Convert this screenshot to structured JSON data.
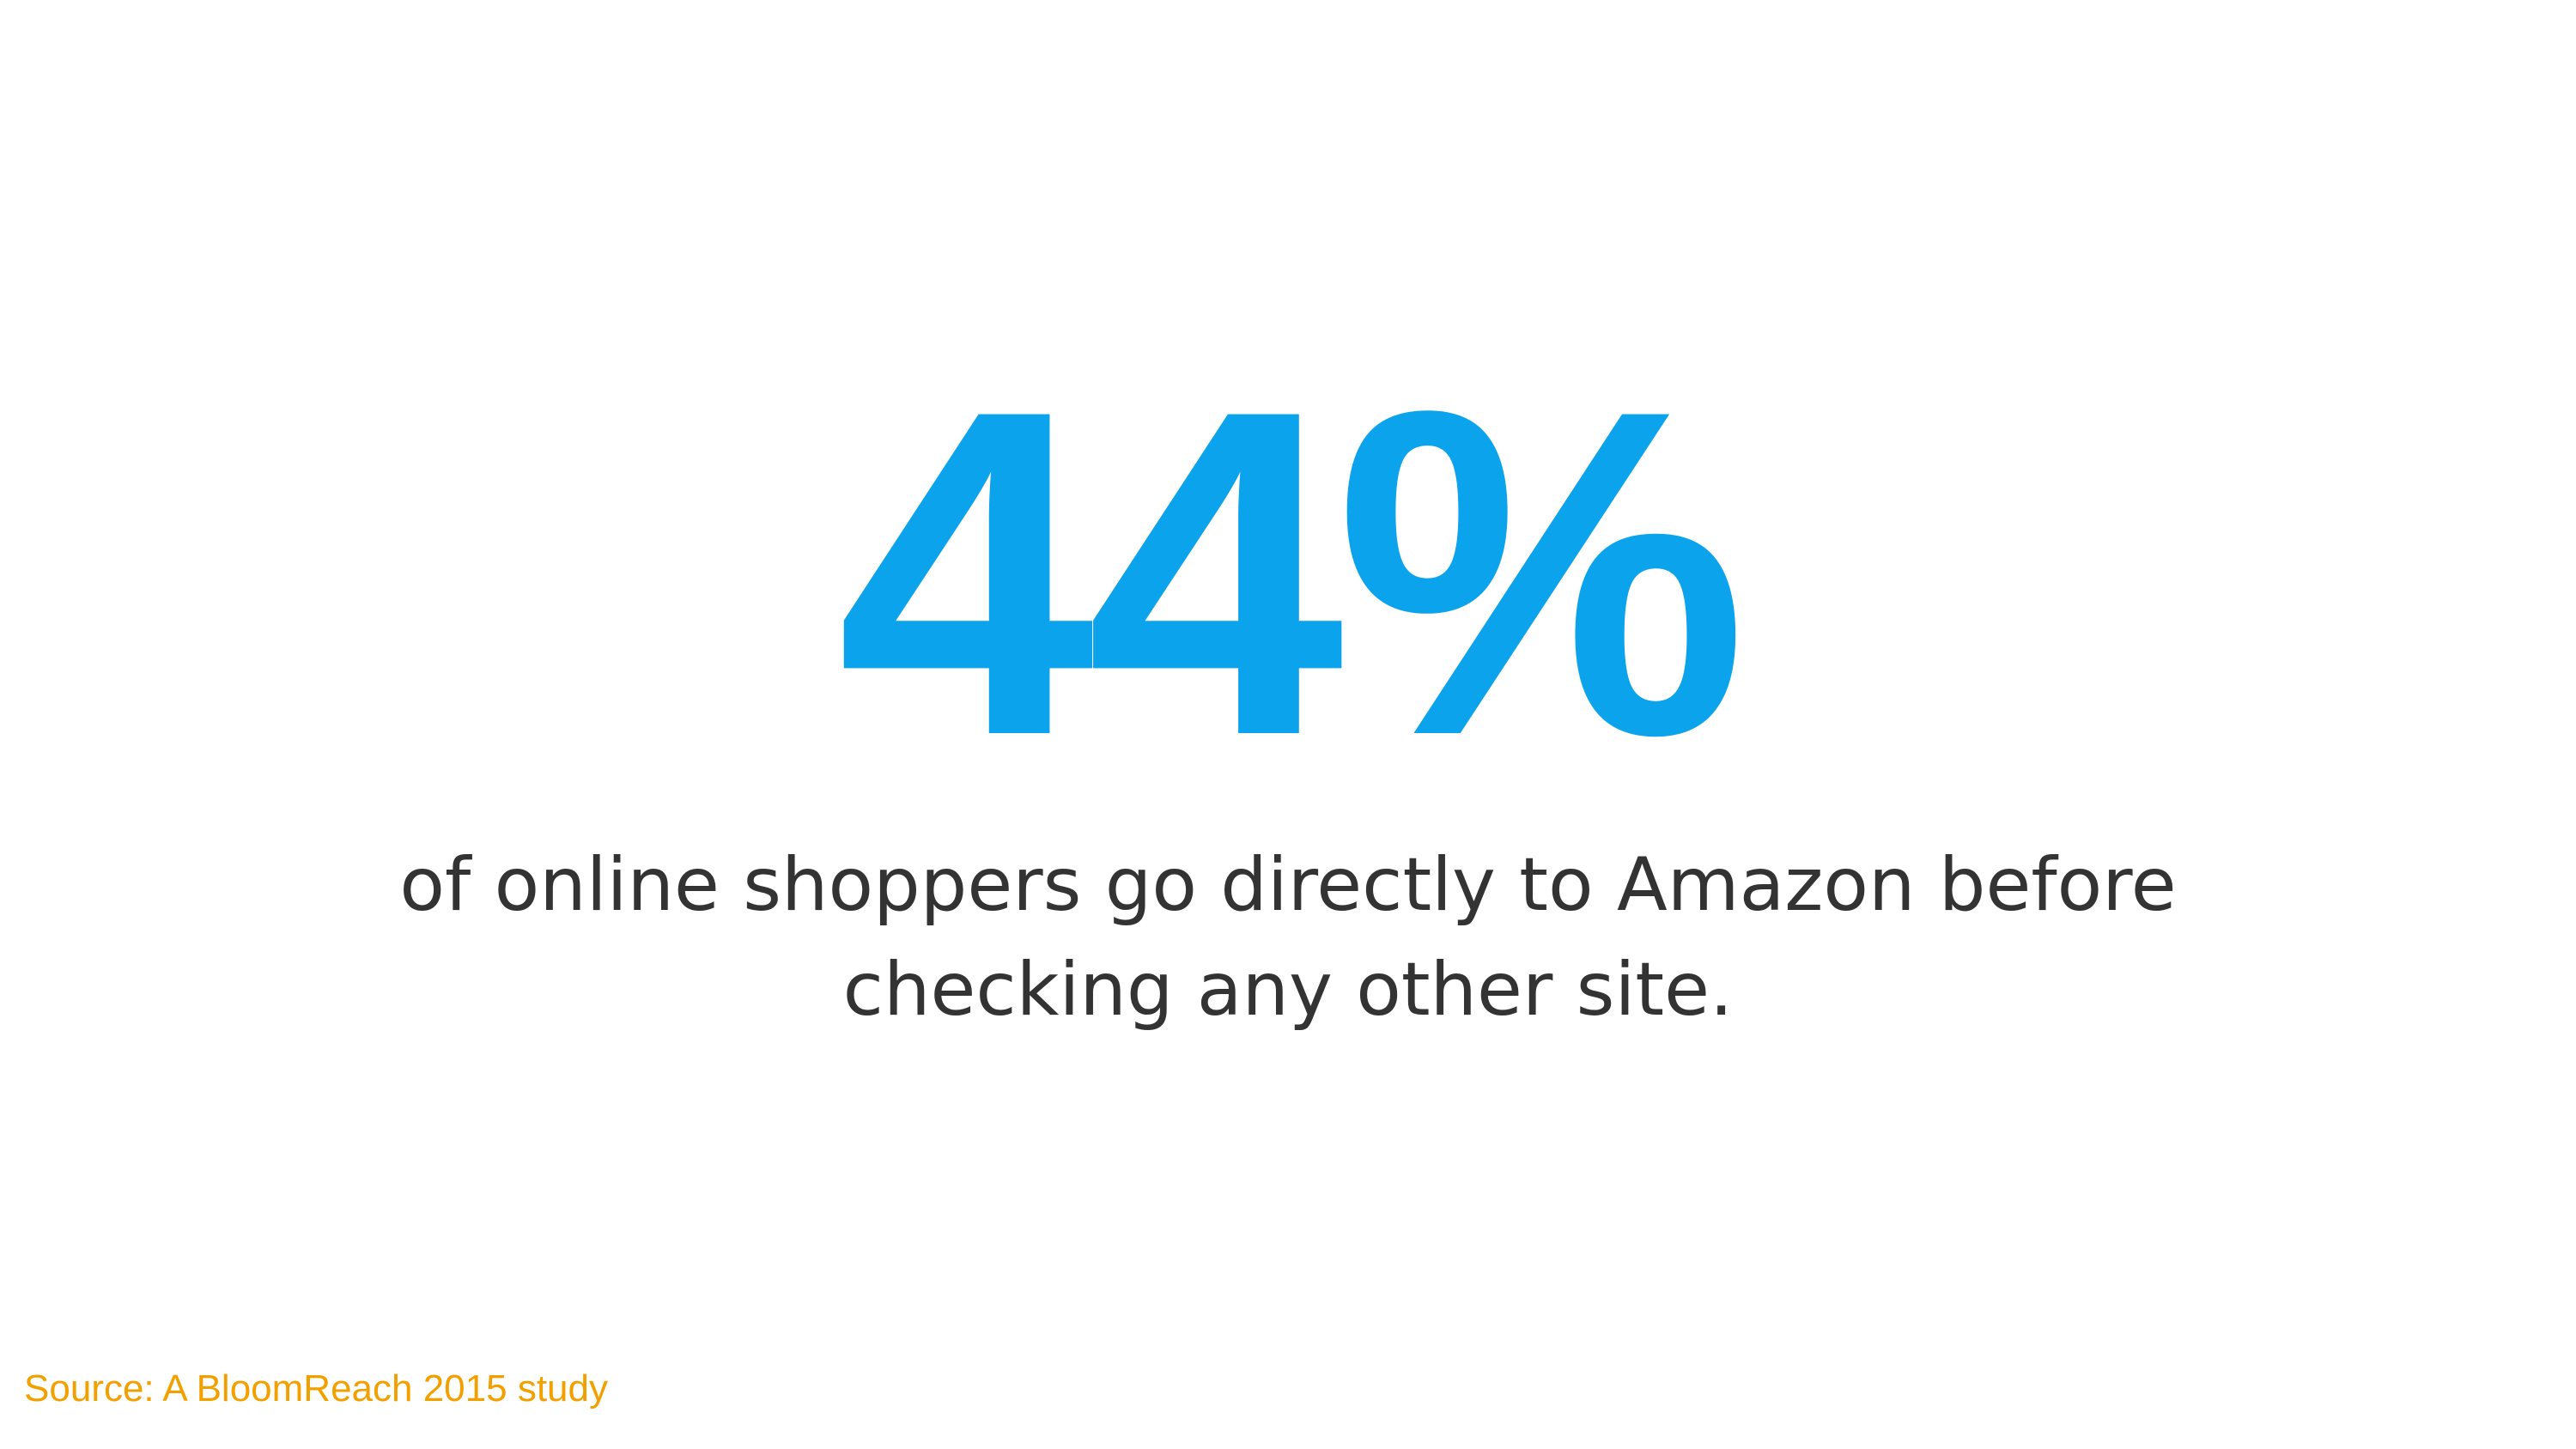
{
  "slide": {
    "statistic": "44%",
    "caption_lines": [
      "of online shoppers go directly to Amazon before",
      "checking any other site."
    ],
    "source": "Source: A BloomReach 2015 study"
  },
  "colors": {
    "accent": "#0ba3ec",
    "text": "#333333",
    "source": "#f2a000",
    "background": "#ffffff"
  }
}
